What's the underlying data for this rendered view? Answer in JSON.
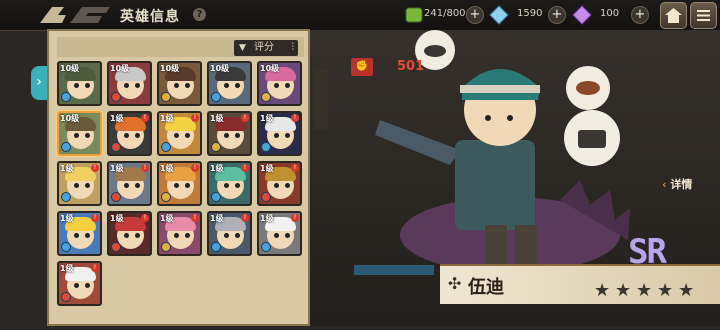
{
  "header": {
    "title": "英雄信息",
    "help": "?"
  },
  "resources": [
    {
      "name": "energy",
      "icon": "stamina-icon",
      "value": "241/800",
      "color": "#7ab83b"
    },
    {
      "name": "crystal",
      "icon": "crystal-icon",
      "value": "1590",
      "color": "#8fd0f0"
    },
    {
      "name": "gem",
      "icon": "gem-icon",
      "value": "100",
      "color": "#c48ee8"
    }
  ],
  "panel": {
    "sort_label": "评分"
  },
  "heroes": [
    {
      "level": "10级",
      "hair": "#4d5b3a",
      "bg": "#5a6a4a",
      "element": "#4aa3d8",
      "dot": false
    },
    {
      "level": "10级",
      "hair": "#c9c9c9",
      "bg": "#8a3b3b",
      "element": "#d94b3b",
      "dot": false
    },
    {
      "level": "10级",
      "hair": "#5a3a2a",
      "bg": "#7a5a3a",
      "element": "#e0b040",
      "dot": false
    },
    {
      "level": "10级",
      "hair": "#3a3a3a",
      "bg": "#5a6a7a",
      "element": "#4aa3d8",
      "dot": false
    },
    {
      "level": "10级",
      "hair": "#d86aa0",
      "bg": "#6a4a7a",
      "element": "#e0b040",
      "dot": false
    },
    {
      "level": "10级",
      "hair": "#6a5a3a",
      "bg": "#7a8a5a",
      "element": "#4aa3d8",
      "dot": false
    },
    {
      "level": "1级",
      "hair": "#e0702a",
      "bg": "#3a3a3a",
      "element": "#d94b3b",
      "dot": true
    },
    {
      "level": "1级",
      "hair": "#f5d040",
      "bg": "#c08a3a",
      "element": "#4aa3d8",
      "dot": true
    },
    {
      "level": "1级",
      "hair": "#8a2a2a",
      "bg": "#5a4a3a",
      "element": "#e0b040",
      "dot": true
    },
    {
      "level": "1级",
      "hair": "#e8e8e8",
      "bg": "#2a2a4a",
      "element": "#4aa3d8",
      "dot": true
    },
    {
      "level": "1级",
      "hair": "#f0d060",
      "bg": "#c0a060",
      "element": "#4aa3d8",
      "dot": true
    },
    {
      "level": "1级",
      "hair": "#a07a4a",
      "bg": "#6a7a8a",
      "element": "#d94b3b",
      "dot": true
    },
    {
      "level": "1级",
      "hair": "#e8a040",
      "bg": "#c07a3a",
      "element": "#e0b040",
      "dot": true
    },
    {
      "level": "1级",
      "hair": "#5ac0a0",
      "bg": "#3a6a6a",
      "element": "#4aa3d8",
      "dot": true
    },
    {
      "level": "1级",
      "hair": "#c09030",
      "bg": "#8a3a2a",
      "element": "#d94b3b",
      "dot": true
    },
    {
      "level": "1级",
      "hair": "#f5d040",
      "bg": "#4a7ab8",
      "element": "#4aa3d8",
      "dot": true
    },
    {
      "level": "1级",
      "hair": "#c83a3a",
      "bg": "#5a2a2a",
      "element": "#d94b3b",
      "dot": true
    },
    {
      "level": "1级",
      "hair": "#e88aa8",
      "bg": "#8a4a6a",
      "element": "#e0b040",
      "dot": true
    },
    {
      "level": "1级",
      "hair": "#b0b0b8",
      "bg": "#4a5a6a",
      "element": "#4aa3d8",
      "dot": true
    },
    {
      "level": "1级",
      "hair": "#f2f2f2",
      "bg": "#7a7a7a",
      "element": "#4aa3d8",
      "dot": true
    },
    {
      "level": "1级",
      "hair": "#f0f0f0",
      "bg": "#a04a3a",
      "element": "#d94b3b",
      "dot": true
    }
  ],
  "selected_index": 5,
  "hero": {
    "name": "伍迪",
    "power": "501",
    "rarity": "SR",
    "stars_filled": 0,
    "stars_total": 5,
    "detail_label": "详情"
  }
}
